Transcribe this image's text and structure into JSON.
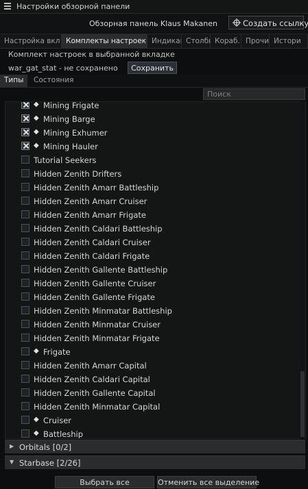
{
  "window": {
    "title": "Настройки обзорной панели"
  },
  "header": {
    "panel_name": "Обзорная панель Klaus Makanen",
    "link_button": "Создать ссылку"
  },
  "tabs": [
    {
      "label": "Настройка вкл",
      "active": false
    },
    {
      "label": "Комплекты настроек в",
      "active": true
    },
    {
      "label": "Индикац",
      "active": false
    },
    {
      "label": "Столбц",
      "active": false
    },
    {
      "label": "Кораб.",
      "active": false
    },
    {
      "label": "Прочие",
      "active": false
    },
    {
      "label": "Истори",
      "active": false
    }
  ],
  "preset": {
    "label": "Комплект настроек в выбранной вкладке",
    "state": "war_gat_stat - не сохранено",
    "save_button": "Сохранить"
  },
  "subtabs": [
    {
      "label": "Типы",
      "active": true
    },
    {
      "label": "Состояния",
      "active": false
    }
  ],
  "search": {
    "placeholder": "Поиск"
  },
  "list_items": [
    {
      "label": "Mining Frigate",
      "checked": true,
      "diamond": true
    },
    {
      "label": "Mining Barge",
      "checked": true,
      "diamond": true
    },
    {
      "label": "Mining Exhumer",
      "checked": true,
      "diamond": true
    },
    {
      "label": "Mining Hauler",
      "checked": true,
      "diamond": true
    },
    {
      "label": "Tutorial Seekers",
      "checked": false,
      "diamond": false
    },
    {
      "label": "Hidden Zenith Drifters",
      "checked": false,
      "diamond": false
    },
    {
      "label": "Hidden Zenith Amarr Battleship",
      "checked": false,
      "diamond": false
    },
    {
      "label": "Hidden Zenith Amarr Cruiser",
      "checked": false,
      "diamond": false
    },
    {
      "label": "Hidden Zenith Amarr Frigate",
      "checked": false,
      "diamond": false
    },
    {
      "label": "Hidden Zenith Caldari Battleship",
      "checked": false,
      "diamond": false
    },
    {
      "label": "Hidden Zenith Caldari Cruiser",
      "checked": false,
      "diamond": false
    },
    {
      "label": "Hidden Zenith Caldari Frigate",
      "checked": false,
      "diamond": false
    },
    {
      "label": "Hidden Zenith  Gallente Battleship",
      "checked": false,
      "diamond": false
    },
    {
      "label": "Hidden Zenith Gallente Cruiser",
      "checked": false,
      "diamond": false
    },
    {
      "label": "Hidden Zenith Gallente Frigate",
      "checked": false,
      "diamond": false
    },
    {
      "label": "Hidden Zenith Minmatar Battleship",
      "checked": false,
      "diamond": false
    },
    {
      "label": "Hidden Zenith Minmatar Cruiser",
      "checked": false,
      "diamond": false
    },
    {
      "label": "Hidden Zenith Minmatar Frigate",
      "checked": false,
      "diamond": false
    },
    {
      "label": "Frigate",
      "checked": false,
      "diamond": true
    },
    {
      "label": "Hidden Zenith Amarr Capital",
      "checked": false,
      "diamond": false
    },
    {
      "label": "Hidden Zenith Caldari Capital",
      "checked": false,
      "diamond": false
    },
    {
      "label": "Hidden Zenith Gallente Capital",
      "checked": false,
      "diamond": false
    },
    {
      "label": "Hidden Zenith Minmatar Capital",
      "checked": false,
      "diamond": false
    },
    {
      "label": "Cruiser",
      "checked": false,
      "diamond": true
    },
    {
      "label": "Battleship",
      "checked": false,
      "diamond": true
    }
  ],
  "groups": [
    {
      "label": "Orbitals [0/2]",
      "expanded": false
    },
    {
      "label": "Starbase [2/26]",
      "expanded": true
    }
  ],
  "footer": {
    "select_all": "Выбрать все",
    "deselect_all": "Отменить все выделение"
  },
  "colors": {
    "background": "#0d0e0f",
    "panel": "#141515",
    "active_tab": "#2b2c2e",
    "text": "#d6d6d6"
  }
}
